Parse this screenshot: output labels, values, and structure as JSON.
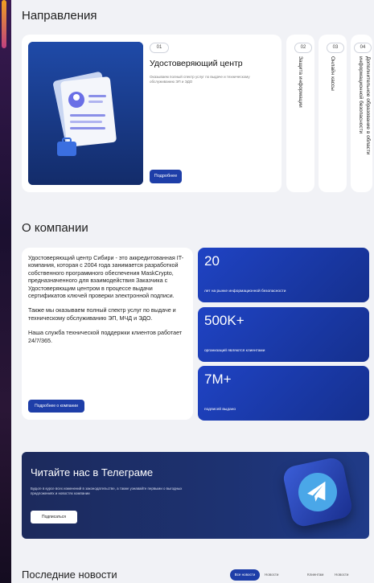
{
  "directions": {
    "title": "Направления",
    "main": {
      "badge": "01",
      "title": "Удостоверяющий центр",
      "desc": "Оказываем полный спектр услуг по выдаче и техническому обслуживанию ЭП и ЭДО",
      "button": "Подробнее"
    },
    "cards": [
      {
        "badge": "02",
        "label": "Защита информации"
      },
      {
        "badge": "03",
        "label": "Онлайн кассы"
      },
      {
        "badge": "04",
        "label": "Дополнительное образование в области информационной безопасности"
      }
    ]
  },
  "about": {
    "title": "О компании",
    "paragraphs": [
      "Удостоверяющий центр Сибири - это аккредитованная IT-компания, которая с 2004 года занимается разработкой собственного программного обеспечения MaskCrypto, предназначенного для взаимодействия Заказчика с Удостоверяющим центром в процессе выдачи сертификатов ключей проверки электронной подписи.",
      "Также мы оказываем полный спектр услуг по выдаче и техническому обслуживанию ЭП, МЧД и ЭДО.",
      "Наша служба технической поддержки клиентов работает 24/7/365."
    ],
    "button": "Подробнее о компании",
    "stats": [
      {
        "value": "20",
        "caption": "лет на рынке информационной безопасности"
      },
      {
        "value": "500K+",
        "caption": "организаций являются клиентами"
      },
      {
        "value": "7M+",
        "caption": "подписей выдано"
      }
    ]
  },
  "telegram": {
    "title": "Читайте нас в Телеграме",
    "desc": "Будьте в курсе всех изменений в законодательстве, а также узнавайте первыми о выгодных предложениях и новостях компании",
    "button": "Подписаться"
  },
  "news": {
    "title": "Последние новости",
    "tabs": [
      "Все новости",
      "Новости компании",
      "Клиентам",
      "Новости сферы"
    ]
  },
  "colors": {
    "accent": "#1e3ea8",
    "page_bg": "#f1f2f6"
  }
}
